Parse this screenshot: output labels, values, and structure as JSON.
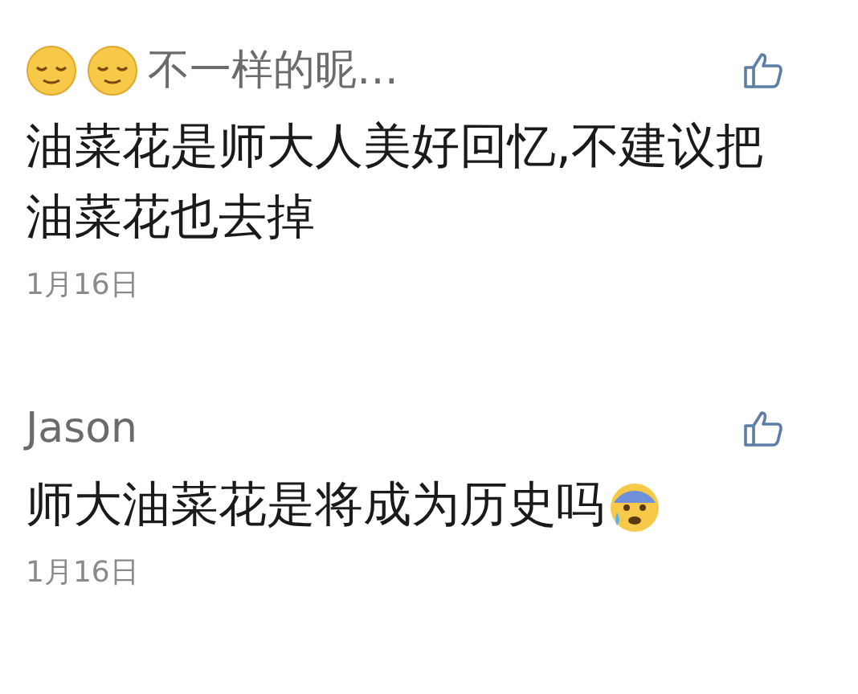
{
  "comments": [
    {
      "name_emojis": [
        {
          "kind": "relieved"
        },
        {
          "kind": "relieved"
        }
      ],
      "name": "不一样的昵…",
      "text": "油菜花是师大人美好回忆,不建议把油菜花也去掉",
      "date": "1月16日"
    },
    {
      "name": "Jason",
      "text": "师大油菜花是将成为历史吗",
      "text_emoji": {
        "kind": "anxious"
      },
      "date": "1月16日"
    }
  ]
}
